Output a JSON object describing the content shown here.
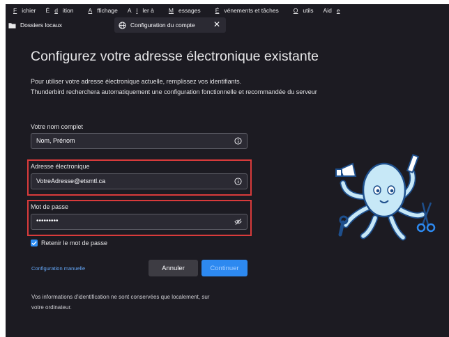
{
  "menubar": {
    "items": [
      {
        "pre": "",
        "key": "F",
        "post": "ichier"
      },
      {
        "pre": "É",
        "key": "d",
        "post": "ition"
      },
      {
        "pre": "",
        "key": "A",
        "post": "ffichage"
      },
      {
        "pre": "A",
        "key": "l",
        "post": "ler à"
      },
      {
        "pre": "",
        "key": "M",
        "post": "essages"
      },
      {
        "pre": "",
        "key": "É",
        "post": "vénements et tâches"
      },
      {
        "pre": "",
        "key": "O",
        "post": "utils"
      },
      {
        "pre": "Aid",
        "key": "e",
        "post": ""
      }
    ]
  },
  "tabs": [
    {
      "label": "Dossiers locaux",
      "icon": "folder-icon"
    },
    {
      "label": "Configuration du compte",
      "icon": "globe-icon",
      "close": "✕"
    }
  ],
  "main": {
    "title": "Configurez votre adresse électronique existante",
    "subtitle_line1": "Pour utiliser votre adresse électronique actuelle, remplissez vos identifiants.",
    "subtitle_line2": "Thunderbird recherchera automatiquement une configuration fonctionnelle et recommandée du serveur",
    "name": {
      "label": "Votre nom complet",
      "value": "Nom, Prénom"
    },
    "email": {
      "label": "Adresse électronique",
      "value": "VotreAdresse@etsmtl.ca"
    },
    "password": {
      "label": "Mot de passe",
      "value": "•••••••••"
    },
    "remember": {
      "label": "Retenir le mot de passe",
      "checked": true
    },
    "manual_config": "Configuration manuelle",
    "cancel": "Annuler",
    "continue": "Continuer",
    "footer_line1": "Vos informations d'identification ne sont conservées que localement, sur",
    "footer_line2": "votre ordinateur."
  },
  "colors": {
    "background": "#1c1b22",
    "field_bg": "#2b2a33",
    "highlight": "#d93b3b",
    "accent": "#2d89f0",
    "link": "#63a5f5"
  }
}
